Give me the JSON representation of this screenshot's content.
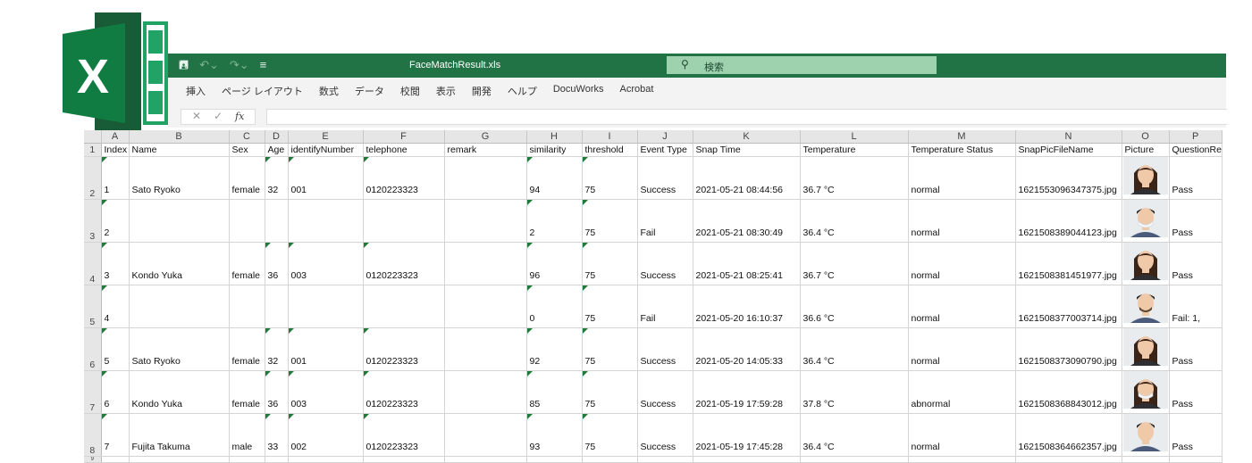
{
  "title_bar": {
    "doc_title": "FaceMatchResult.xls",
    "search_label": "検索",
    "bg_color": "#217346"
  },
  "ribbon": {
    "tabs": [
      "挿入",
      "ページ レイアウト",
      "数式",
      "データ",
      "校閲",
      "表示",
      "開発",
      "ヘルプ",
      "DocuWorks",
      "Acrobat"
    ]
  },
  "formula_bar": {
    "fx_label": "fx",
    "value": ""
  },
  "sheet": {
    "column_letters": [
      "A",
      "B",
      "C",
      "D",
      "E",
      "F",
      "G",
      "H",
      "I",
      "J",
      "K",
      "L",
      "M",
      "N",
      "O",
      "P"
    ],
    "headers": [
      "Index",
      "Name",
      "Sex",
      "Age",
      "identifyNumber",
      "telephone",
      "remark",
      "similarity",
      "threshold",
      "Event Type",
      "Snap Time",
      "Temperature",
      "Temperature Status",
      "SnapPicFileName",
      "Picture",
      "QuestionRe"
    ],
    "header_row_num": "1",
    "rows": [
      {
        "row": "2",
        "cells": [
          "1",
          "Sato Ryoko",
          "female",
          "32",
          "001",
          "0120223323",
          "",
          "94",
          "75",
          "Success",
          "2021-05-21 08:44:56",
          "36.7 °C",
          "normal",
          "1621553096347375.jpg",
          "",
          "Pass"
        ],
        "face": "woman-1"
      },
      {
        "row": "3",
        "cells": [
          "2",
          "",
          "",
          "",
          "",
          "",
          "",
          "2",
          "75",
          "Fail",
          "2021-05-21 08:30:49",
          "36.4 °C",
          "normal",
          "1621508389044123.jpg",
          "",
          "Pass"
        ],
        "face": "man-mask"
      },
      {
        "row": "4",
        "cells": [
          "3",
          "Kondo Yuka",
          "female",
          "36",
          "003",
          "0120223323",
          "",
          "96",
          "75",
          "Success",
          "2021-05-21 08:25:41",
          "36.7 °C",
          "normal",
          "1621508381451977.jpg",
          "",
          "Pass"
        ],
        "face": "woman-2"
      },
      {
        "row": "5",
        "cells": [
          "4",
          "",
          "",
          "",
          "",
          "",
          "",
          "0",
          "75",
          "Fail",
          "2021-05-20 16:10:37",
          "36.6 °C",
          "normal",
          "1621508377003714.jpg",
          "",
          "Fail: 1,"
        ],
        "face": "man-beard"
      },
      {
        "row": "6",
        "cells": [
          "5",
          "Sato Ryoko",
          "female",
          "32",
          "001",
          "0120223323",
          "",
          "92",
          "75",
          "Success",
          "2021-05-20 14:05:33",
          "36.4 °C",
          "normal",
          "1621508373090790.jpg",
          "",
          "Pass"
        ],
        "face": "woman-1"
      },
      {
        "row": "7",
        "cells": [
          "6",
          "Kondo Yuka",
          "female",
          "36",
          "003",
          "0120223323",
          "",
          "85",
          "75",
          "Success",
          "2021-05-19 17:59:28",
          "37.8 °C",
          "abnormal",
          "1621508368843012.jpg",
          "",
          "Pass"
        ],
        "face": "woman-mask"
      },
      {
        "row": "8",
        "cells": [
          "7",
          "Fujita Takuma",
          "male",
          "33",
          "002",
          "0120223323",
          "",
          "93",
          "75",
          "Success",
          "2021-05-19 17:45:28",
          "36.4 °C",
          "normal",
          "1621508364662357.jpg",
          "",
          "Pass"
        ],
        "face": "man-smile"
      }
    ],
    "tail_row_num": "9"
  }
}
